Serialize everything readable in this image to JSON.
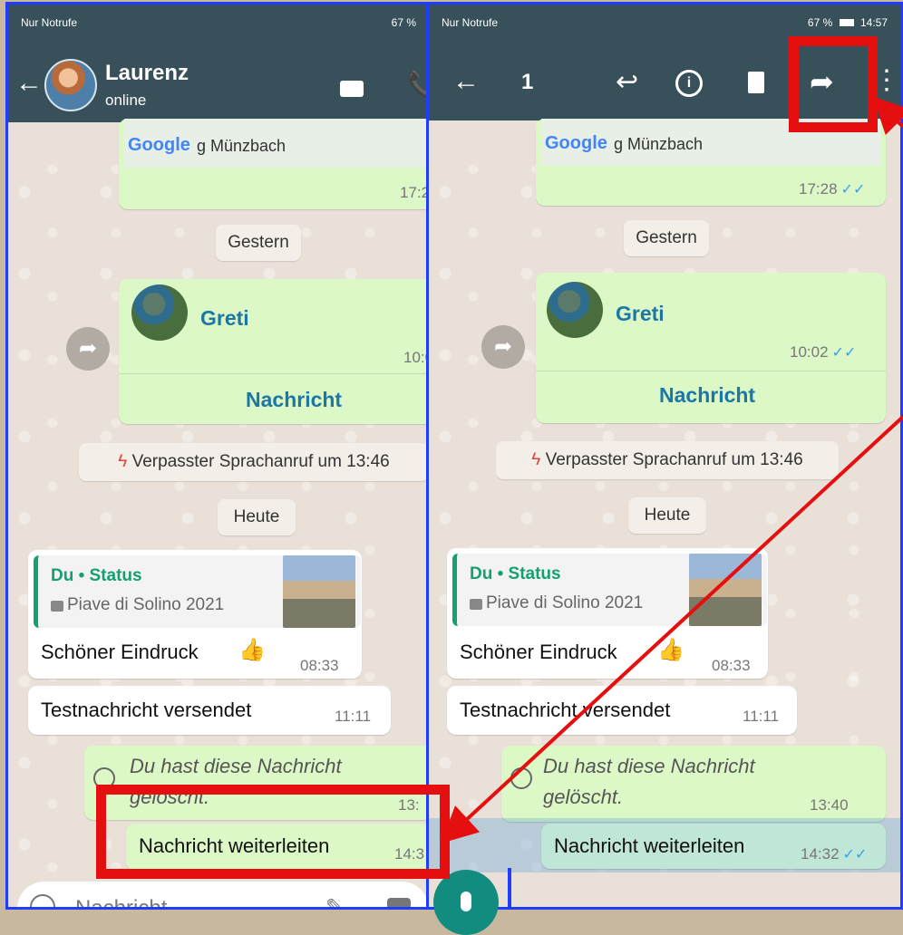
{
  "status": {
    "carrier": "Nur Notrufe",
    "battery": "67 %",
    "clock": "14:57"
  },
  "left": {
    "contact_name": "Laurenz",
    "contact_status": "online",
    "map_label": "Google",
    "map_place": "g Münzbach",
    "map_time": "17:2",
    "date_yesterday": "Gestern",
    "card_name": "Greti",
    "card_time": "10:0",
    "card_action": "Nachricht",
    "missed_call": "Verpasster Sprachanruf um 13:46",
    "date_today": "Heute",
    "status_quote_title": "Du • Status",
    "status_quote_caption": "Piave di Solino 2021",
    "msg1": "Schöner Eindruck",
    "msg1_time": "08:33",
    "msg2": "Testnachricht versendet",
    "msg2_time": "11:11",
    "deleted_line1": "Du hast diese Nachricht",
    "deleted_line2": "gelöscht.",
    "deleted_time": "13:",
    "forward_msg": "Nachricht weiterleiten",
    "forward_time": "14:3",
    "input_placeholder": "Nachricht"
  },
  "right": {
    "selected_count": "1",
    "map_label": "Google",
    "map_place": "g Münzbach",
    "map_time": "17:28",
    "date_yesterday": "Gestern",
    "card_name": "Greti",
    "card_time": "10:02",
    "card_action": "Nachricht",
    "missed_call": "Verpasster Sprachanruf um 13:46",
    "date_today": "Heute",
    "status_quote_title": "Du • Status",
    "status_quote_caption": "Piave di Solino 2021",
    "msg1": "Schöner Eindruck",
    "msg1_time": "08:33",
    "msg2": "Testnachricht versendet",
    "msg2_time": "11:11",
    "deleted_line1": "Du hast diese Nachricht",
    "deleted_line2": "gelöscht.",
    "deleted_time": "13:40",
    "forward_msg": "Nachricht weiterleiten",
    "forward_time": "14:32"
  },
  "icons": {
    "back": "arrow-left-icon",
    "video": "video-icon",
    "call": "phone-icon",
    "reply": "reply-icon",
    "info": "info-icon",
    "delete": "trash-icon",
    "forward": "forward-icon",
    "more": "more-vert-icon",
    "emoji": "emoji-icon",
    "attach": "paperclip-icon",
    "camera": "camera-icon",
    "mic": "mic-icon"
  },
  "colors": {
    "header": "#37505a",
    "bubble_out": "#dcf8c6",
    "highlight": "#e50f0f",
    "frame": "#1f3cff",
    "link": "#1b77a6",
    "ticks": "#3aa0e8",
    "mic_button": "#128c7e"
  }
}
